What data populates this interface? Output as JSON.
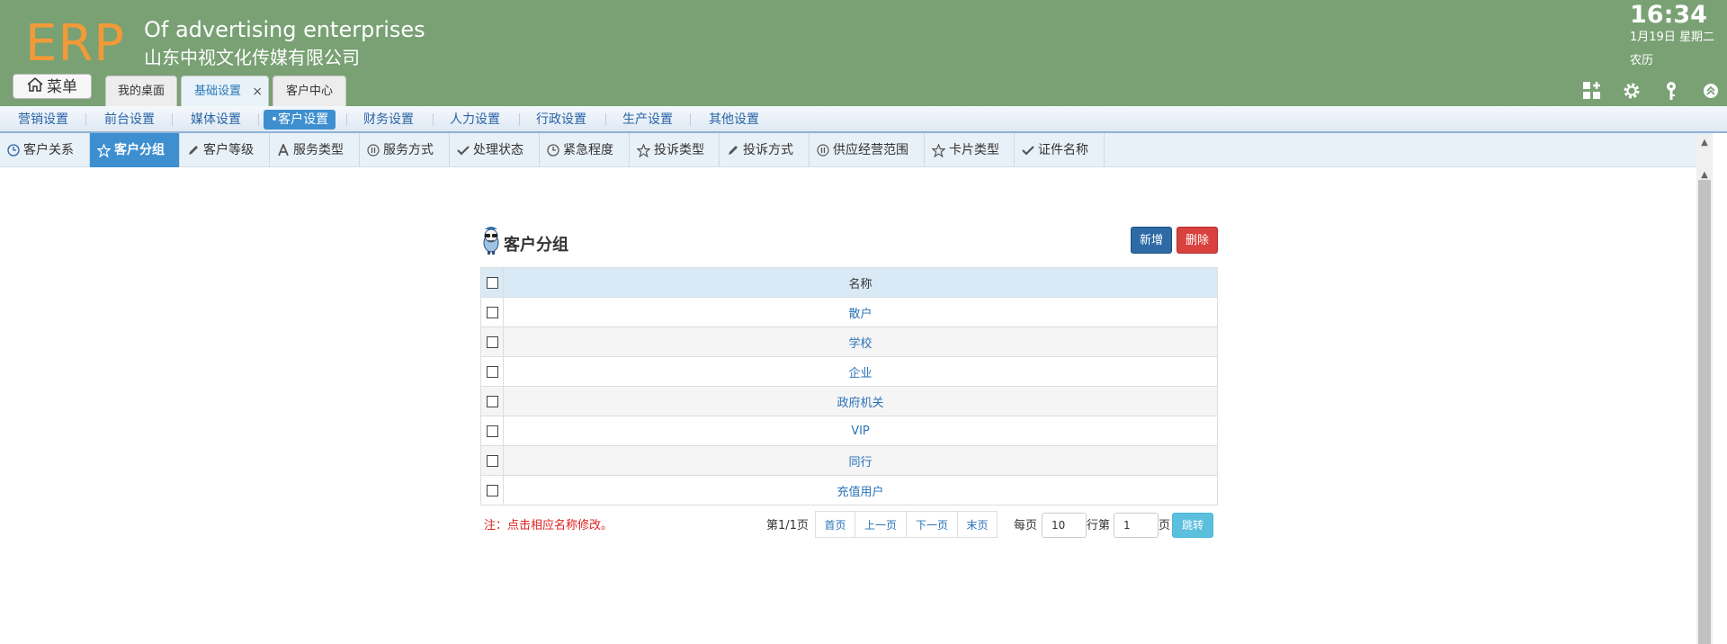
{
  "header": {
    "logo": "ERP",
    "company_en": "Of advertising enterprises",
    "company_cn": "山东中视文化传媒有限公司",
    "time": "16:34",
    "date": "1月19日 星期二",
    "lunar": "农历",
    "menu_label": "菜单",
    "tabs": [
      {
        "label": "我的桌面"
      },
      {
        "label": "基础设置",
        "close": "×"
      },
      {
        "label": "客户中心"
      }
    ]
  },
  "nav1": [
    "营销设置",
    "前台设置",
    "媒体设置",
    "•客户设置",
    "财务设置",
    "人力设置",
    "行政设置",
    "生产设置",
    "其他设置"
  ],
  "nav2": [
    "客户关系",
    "客户分组",
    "客户等级",
    "服务类型",
    "服务方式",
    "处理状态",
    "紧急程度",
    "投诉类型",
    "投诉方式",
    "供应经营范围",
    "卡片类型",
    "证件名称"
  ],
  "panel": {
    "title": "客户分组",
    "new_label": "新增",
    "delete_label": "删除",
    "column_header": "名称",
    "rows": [
      "散户",
      "学校",
      "企业",
      "政府机关",
      "VIP",
      "同行",
      "充值用户"
    ],
    "note": "注：点击相应名称修改。"
  },
  "pager": {
    "info": "第1/1页",
    "first": "首页",
    "prev": "上一页",
    "next": "下一页",
    "last": "末页",
    "per_page_label": "每页",
    "per_page_value": "10",
    "rows_label": "行第",
    "page_value": "1",
    "page_label": "页",
    "jump": "跳转"
  }
}
